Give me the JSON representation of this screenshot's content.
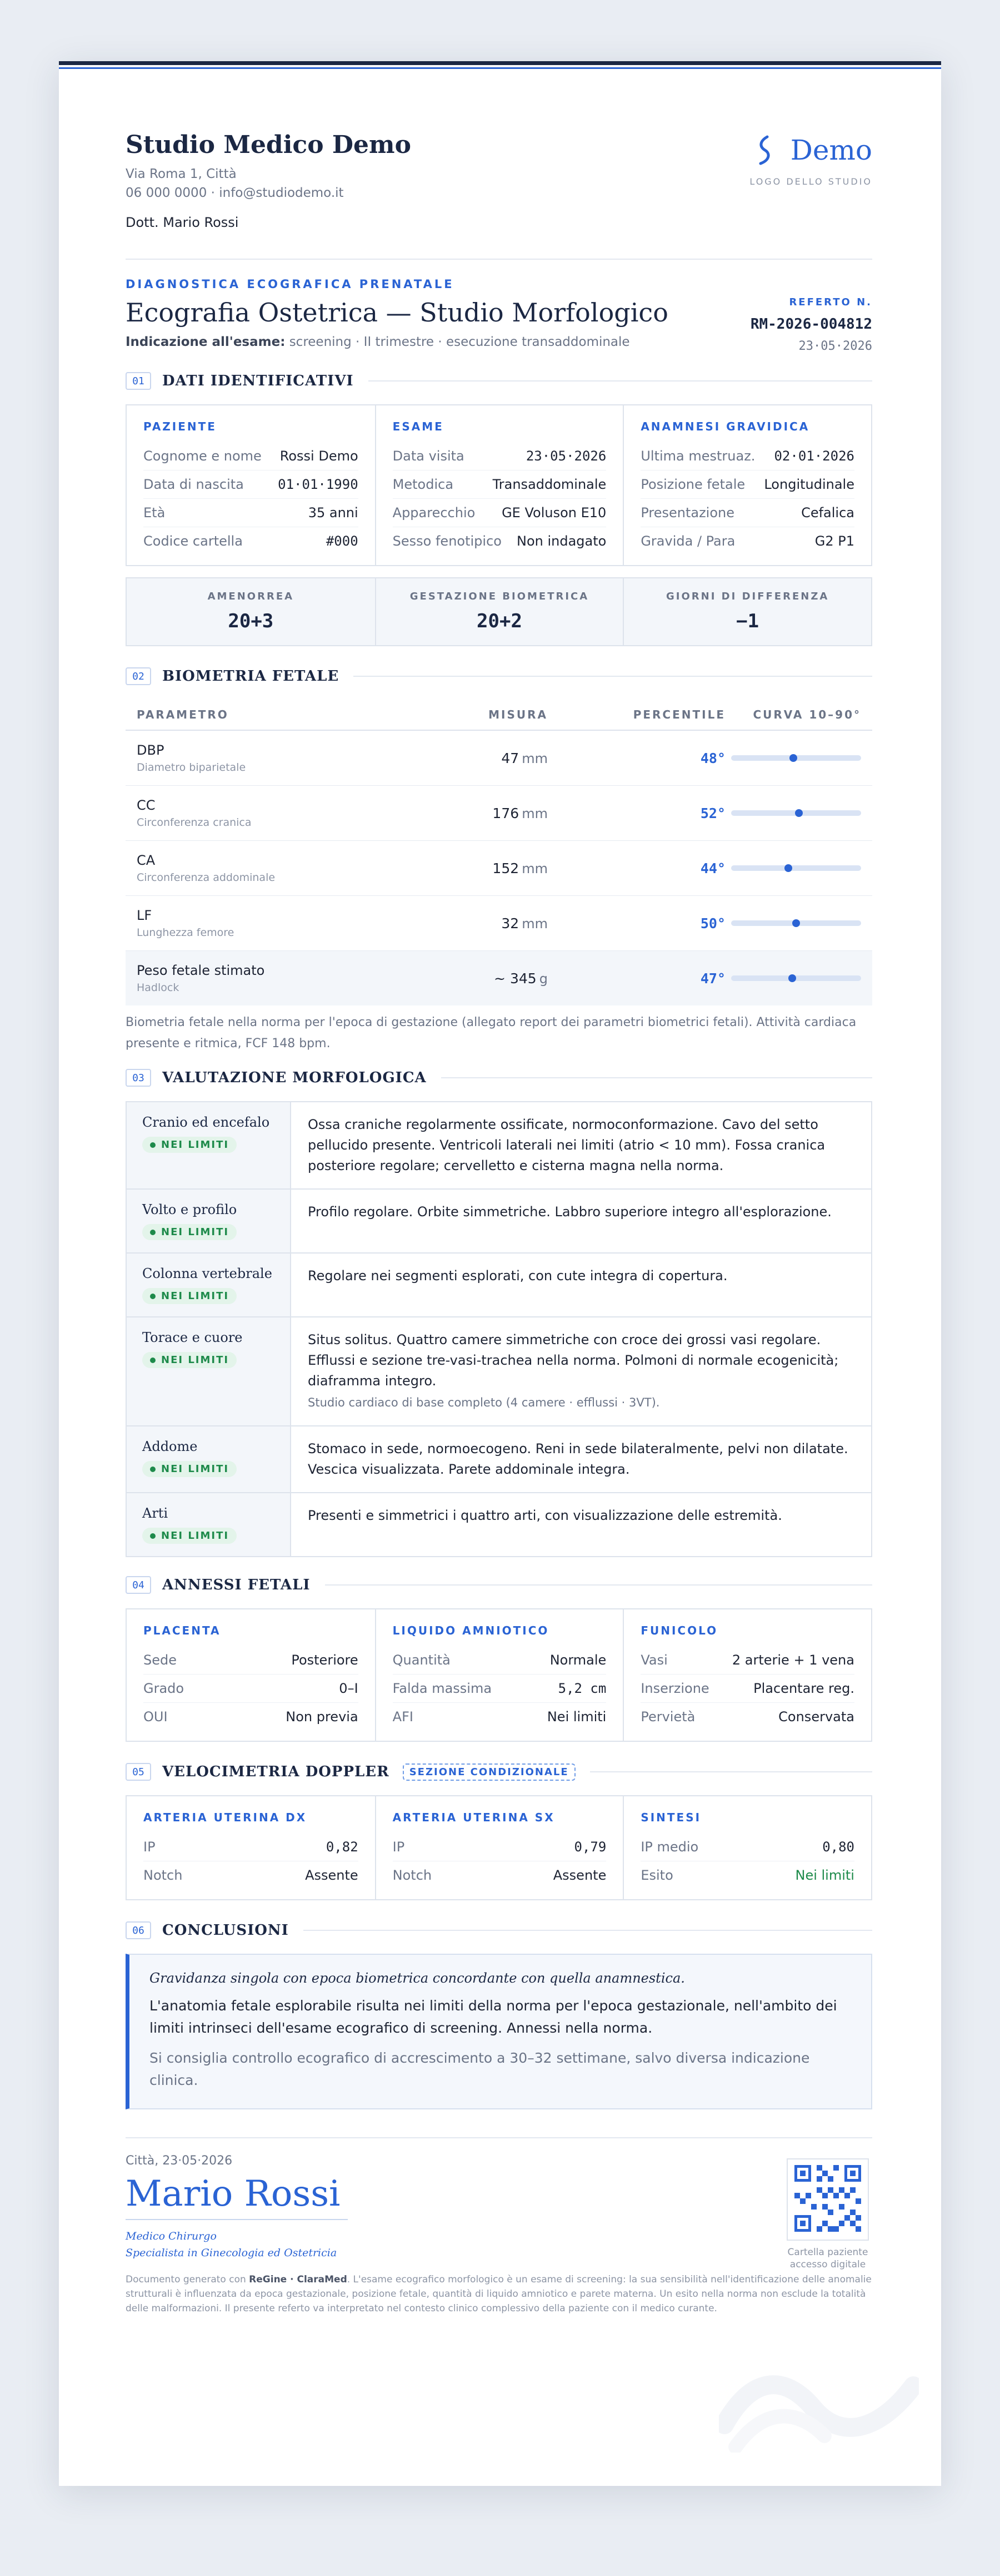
{
  "studio": {
    "name": "Studio Medico Demo",
    "address": "Via Roma 1, Città",
    "contacts": "06 000 0000 · info@studiodemo.it",
    "doctor": "Dott. Mario Rossi",
    "logo_name": "Demo",
    "logo_caption": "LOGO DELLO STUDIO"
  },
  "report": {
    "kicker": "DIAGNOSTICA ECOGRAFICA PRENATALE",
    "title": "Ecografia Ostetrica — Studio Morfologico",
    "indication_label": "Indicazione all'esame:",
    "indication_text": " screening · II trimestre · esecuzione transaddominale",
    "ref_label": "REFERTO N.",
    "ref_number": "RM-2026-004812",
    "ref_date": "23·05·2026"
  },
  "sections": {
    "s1": {
      "num": "01",
      "title": "DATI IDENTIFICATIVI"
    },
    "s2": {
      "num": "02",
      "title": "BIOMETRIA FETALE"
    },
    "s3": {
      "num": "03",
      "title": "VALUTAZIONE MORFOLOGICA"
    },
    "s4": {
      "num": "04",
      "title": "ANNESSI FETALI"
    },
    "s5": {
      "num": "05",
      "title": "VELOCIMETRIA DOPPLER",
      "badge": "SEZIONE CONDIZIONALE"
    },
    "s6": {
      "num": "06",
      "title": "CONCLUSIONI"
    }
  },
  "ident": {
    "patient": {
      "title": "PAZIENTE",
      "rows": [
        {
          "k": "Cognome e nome",
          "v": "Rossi Demo"
        },
        {
          "k": "Data di nascita",
          "v": "01·01·1990"
        },
        {
          "k": "Età",
          "v": "35 anni"
        },
        {
          "k": "Codice cartella",
          "v": "#000"
        }
      ]
    },
    "exam": {
      "title": "ESAME",
      "rows": [
        {
          "k": "Data visita",
          "v": "23·05·2026"
        },
        {
          "k": "Metodica",
          "v": "Transaddominale"
        },
        {
          "k": "Apparecchio",
          "v": "GE Voluson E10"
        },
        {
          "k": "Sesso fenotipico",
          "v": "Non indagato"
        }
      ]
    },
    "anamnesis": {
      "title": "ANAMNESI GRAVIDICA",
      "rows": [
        {
          "k": "Ultima mestruaz.",
          "v": "02·01·2026"
        },
        {
          "k": "Posizione fetale",
          "v": "Longitudinale"
        },
        {
          "k": "Presentazione",
          "v": "Cefalica"
        },
        {
          "k": "Gravida / Para",
          "v": "G2 P1"
        }
      ]
    },
    "ga": [
      {
        "label": "AMENORREA",
        "value": "20+3"
      },
      {
        "label": "GESTAZIONE BIOMETRICA",
        "value": "20+2"
      },
      {
        "label": "GIORNI DI DIFFERENZA",
        "value": "−1"
      }
    ]
  },
  "biometry": {
    "headers": {
      "param": "PARAMETRO",
      "meas": "MISURA",
      "perc": "PERCENTILE",
      "curve": "CURVA 10–90°"
    },
    "rows": [
      {
        "name": "DBP",
        "sub": "Diametro biparietale",
        "value": "47",
        "unit": "mm",
        "perc": "48°",
        "pos": 48
      },
      {
        "name": "CC",
        "sub": "Circonferenza cranica",
        "value": "176",
        "unit": "mm",
        "perc": "52°",
        "pos": 52
      },
      {
        "name": "CA",
        "sub": "Circonferenza addominale",
        "value": "152",
        "unit": "mm",
        "perc": "44°",
        "pos": 44
      },
      {
        "name": "LF",
        "sub": "Lunghezza femore",
        "value": "32",
        "unit": "mm",
        "perc": "50°",
        "pos": 50
      },
      {
        "name": "Peso fetale stimato",
        "sub": "Hadlock",
        "value": "~ 345",
        "unit": "g",
        "perc": "47°",
        "pos": 47
      }
    ],
    "note": "Biometria fetale nella norma per l'epoca di gestazione (allegato report dei parametri biometrici fetali). Attività cardiaca presente e ritmica, FCF 148 bpm."
  },
  "morphology": {
    "badge": "NEI LIMITI",
    "rows": [
      {
        "organ": "Cranio ed encefalo",
        "text": "Ossa craniche regolarmente ossificate, normoconformazione. Cavo del setto pellucido presente. Ventricoli laterali nei limiti (atrio < 10 mm). Fossa cranica posteriore regolare; cervelletto e cisterna magna nella norma.",
        "note": ""
      },
      {
        "organ": "Volto e profilo",
        "text": "Profilo regolare. Orbite simmetriche. Labbro superiore integro all'esplorazione.",
        "note": ""
      },
      {
        "organ": "Colonna vertebrale",
        "text": "Regolare nei segmenti esplorati, con cute integra di copertura.",
        "note": ""
      },
      {
        "organ": "Torace e cuore",
        "text": "Situs solitus. Quattro camere simmetriche con croce dei grossi vasi regolare. Efflussi e sezione tre-vasi-trachea nella norma. Polmoni di normale ecogenicità; diaframma integro.",
        "note": "Studio cardiaco di base completo (4 camere · efflussi · 3VT)."
      },
      {
        "organ": "Addome",
        "text": "Stomaco in sede, normoecogeno. Reni in sede bilateralmente, pelvi non dilatate. Vescica visualizzata. Parete addominale integra.",
        "note": ""
      },
      {
        "organ": "Arti",
        "text": "Presenti e simmetrici i quattro arti, con visualizzazione delle estremità.",
        "note": ""
      }
    ]
  },
  "annexes": {
    "placenta": {
      "title": "PLACENTA",
      "rows": [
        {
          "k": "Sede",
          "v": "Posteriore"
        },
        {
          "k": "Grado",
          "v": "0–I"
        },
        {
          "k": "OUI",
          "v": "Non previa"
        }
      ]
    },
    "liquid": {
      "title": "LIQUIDO AMNIOTICO",
      "rows": [
        {
          "k": "Quantità",
          "v": "Normale"
        },
        {
          "k": "Falda massima",
          "v": "5,2 cm"
        },
        {
          "k": "AFI",
          "v": "Nei limiti"
        }
      ]
    },
    "cord": {
      "title": "FUNICOLO",
      "rows": [
        {
          "k": "Vasi",
          "v": "2 arterie + 1 vena"
        },
        {
          "k": "Inserzione",
          "v": "Placentare reg."
        },
        {
          "k": "Pervietà",
          "v": "Conservata"
        }
      ]
    }
  },
  "doppler": {
    "right": {
      "title": "ARTERIA UTERINA DX",
      "rows": [
        {
          "k": "IP",
          "v": "0,82"
        },
        {
          "k": "Notch",
          "v": "Assente"
        }
      ]
    },
    "left": {
      "title": "ARTERIA UTERINA SX",
      "rows": [
        {
          "k": "IP",
          "v": "0,79"
        },
        {
          "k": "Notch",
          "v": "Assente"
        }
      ]
    },
    "summary": {
      "title": "SINTESI",
      "rows": [
        {
          "k": "IP medio",
          "v": "0,80"
        },
        {
          "k": "Esito",
          "v": "Nei limiti"
        }
      ]
    }
  },
  "conclusions": {
    "lead": "Gravidanza singola con epoca biometrica concordante con quella anamnestica.",
    "main": "L'anatomia fetale esplorabile risulta nei limiti della norma per l'epoca gestazionale, nell'ambito dei limiti intrinseci dell'esame ecografico di screening. Annessi nella norma.",
    "followup": "Si consiglia controllo ecografico di accrescimento a 30–32 settimane, salvo diversa indicazione clinica."
  },
  "signature": {
    "place_date": "Città, 23·05·2026",
    "name": "Mario Rossi",
    "role1": "Medico Chirurgo",
    "role2": "Specialista in Ginecologia ed Ostetricia",
    "qr_caption1": "Cartella paziente",
    "qr_caption2": "accesso digitale"
  },
  "legal": {
    "prefix": "Documento generato con ",
    "brand": "ReGine · ClaraMed",
    "text": ". L'esame ecografico morfologico è un esame di screening: la sua sensibilità nell'identificazione delle anomalie strutturali è influenzata da epoca gestazionale, posizione fetale, quantità di liquido amniotico e parete materna. Un esito nella norma non esclude la totalità delle malformazioni. Il presente referto va interpretato nel contesto clinico complessivo della paziente con il medico curante."
  },
  "colors": {
    "accent": "#2a63d4",
    "navy": "#1b2743",
    "ok_green": "#1d8a4a"
  }
}
